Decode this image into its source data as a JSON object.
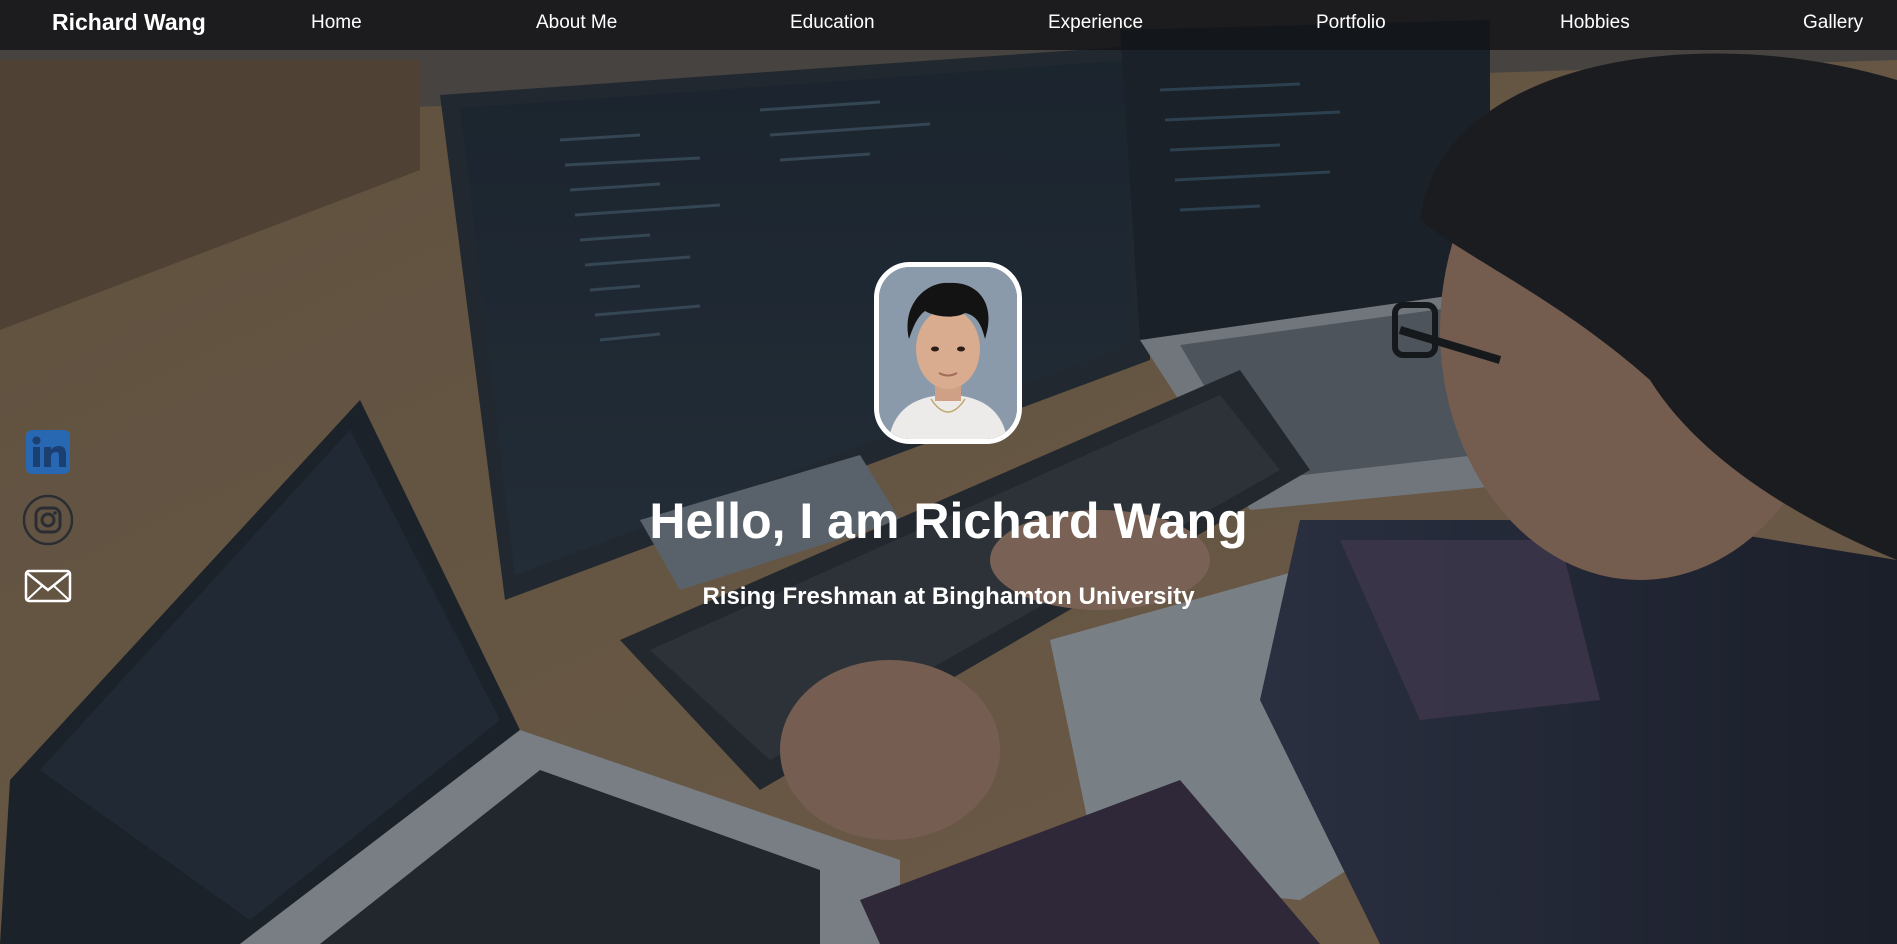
{
  "header": {
    "brand": "Richard Wang"
  },
  "nav": {
    "items": [
      {
        "label": "Home"
      },
      {
        "label": "About Me"
      },
      {
        "label": "Education"
      },
      {
        "label": "Experience"
      },
      {
        "label": "Portfolio"
      },
      {
        "label": "Hobbies"
      },
      {
        "label": "Gallery"
      }
    ]
  },
  "social": {
    "icons": [
      "linkedin-icon",
      "instagram-icon",
      "mail-icon"
    ],
    "linkedin_color": "#2867b2"
  },
  "hero": {
    "title": "Hello, I am Richard Wang",
    "subtitle": "Rising Freshman at Binghamton University"
  }
}
